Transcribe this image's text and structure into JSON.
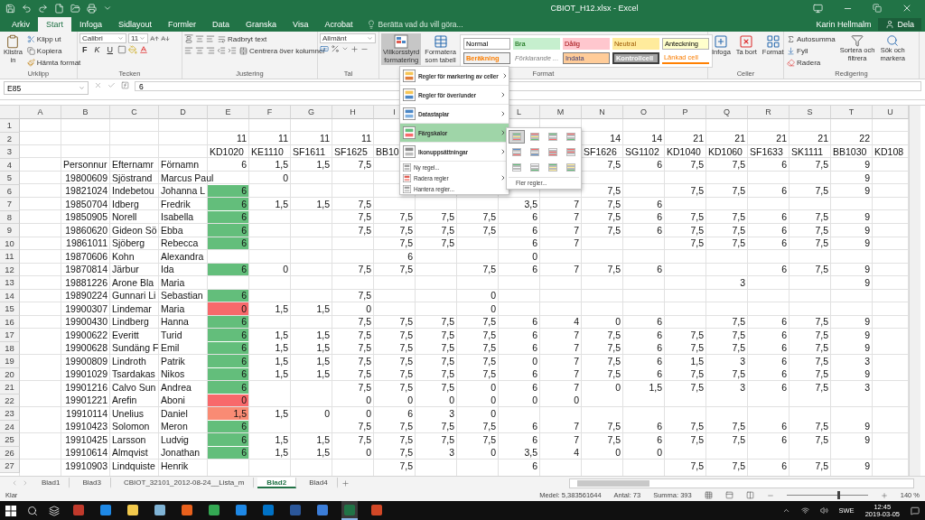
{
  "title_bar": {
    "title": "CBIOT_H12.xlsx - Excel"
  },
  "ribbon_tabs": [
    {
      "label": "Arkiv",
      "selected": false
    },
    {
      "label": "Start",
      "selected": true
    },
    {
      "label": "Infoga",
      "selected": false
    },
    {
      "label": "Sidlayout",
      "selected": false
    },
    {
      "label": "Formler",
      "selected": false
    },
    {
      "label": "Data",
      "selected": false
    },
    {
      "label": "Granska",
      "selected": false
    },
    {
      "label": "Visa",
      "selected": false
    },
    {
      "label": "Acrobat",
      "selected": false
    }
  ],
  "tell_me": {
    "placeholder": "Berätta vad du vill göra..."
  },
  "user": "Karin Hellmalm",
  "share_button": "Dela",
  "ribbon": {
    "clipboard": {
      "label": "Urklipp",
      "paste_top": "Klistra",
      "paste_bottom": "in",
      "cut": "Klipp ut",
      "copy": "Kopiera",
      "format_painter": "Hämta format"
    },
    "font": {
      "label": "Tecken",
      "font_name": "Calibri",
      "font_size": "11",
      "bold": "F",
      "italic": "K",
      "underline": "U"
    },
    "alignment": {
      "label": "Justering",
      "wrap": "Radbryt text",
      "merge": "Centrera över kolumner"
    },
    "number": {
      "label": "Tal",
      "format": "Allmänt"
    },
    "styles": {
      "label": "Format",
      "conditional_top": "Villkorsstyrd",
      "conditional_bottom": "formatering",
      "conditional_open": true,
      "table_top": "Formatera",
      "table_bottom": "som tabell",
      "cell_styles": [
        {
          "label": "Normal",
          "kind": "normal"
        },
        {
          "label": "Bra",
          "kind": "good"
        },
        {
          "label": "Dålig",
          "kind": "bad"
        },
        {
          "label": "Neutral",
          "kind": "neutral"
        },
        {
          "label": "Anteckning",
          "kind": "note"
        },
        {
          "label": "Beräkning",
          "kind": "calc"
        },
        {
          "label": "Förklarande ...",
          "kind": "explanatory"
        },
        {
          "label": "Indata",
          "kind": "input"
        },
        {
          "label": "Kontrollcell",
          "kind": "check"
        },
        {
          "label": "Länkad cell",
          "kind": "linked"
        }
      ]
    },
    "cells": {
      "label": "Celler",
      "insert": "Infoga",
      "delete": "Ta bort",
      "format": "Format"
    },
    "editing": {
      "label": "Redigering",
      "autosum": "Autosumma",
      "fill": "Fyll",
      "clear": "Radera",
      "sort_top": "Sortera och",
      "sort_bottom": "filtrera",
      "find_top": "Sök och",
      "find_bottom": "markera"
    }
  },
  "formula_bar": {
    "name_box": "E85",
    "value": "6"
  },
  "conditional_menu": {
    "items": [
      {
        "label": "Regler för markering av celler",
        "kind": "large",
        "submenu": true,
        "selected": false
      },
      {
        "label": "Regler för över/under",
        "kind": "large",
        "submenu": true,
        "selected": false
      },
      {
        "label": "Datastaplar",
        "kind": "large",
        "submenu": true,
        "selected": false
      },
      {
        "label": "Färgskalor",
        "kind": "large",
        "submenu": true,
        "selected": true
      },
      {
        "label": "Ikonuppsättningar",
        "kind": "large",
        "submenu": true,
        "selected": false
      },
      {
        "label": "Ny regel...",
        "kind": "small",
        "submenu": false,
        "selected": false
      },
      {
        "label": "Radera regler",
        "kind": "small",
        "submenu": true,
        "selected": false
      },
      {
        "label": "Hantera regler...",
        "kind": "small",
        "submenu": false,
        "selected": false
      }
    ],
    "color_scales": [
      {
        "selected": true
      },
      {
        "selected": false
      },
      {
        "selected": false
      },
      {
        "selected": false
      },
      {
        "selected": false
      },
      {
        "selected": false
      },
      {
        "selected": false
      },
      {
        "selected": false
      },
      {
        "selected": false
      },
      {
        "selected": false
      },
      {
        "selected": false
      },
      {
        "selected": false
      }
    ],
    "more": "Fler regler..."
  },
  "columns": [
    "A",
    "B",
    "C",
    "D",
    "E",
    "F",
    "G",
    "H",
    "I",
    null,
    null,
    "L",
    "M",
    "N",
    "O",
    "P",
    "Q",
    "R",
    "S",
    "T",
    "U"
  ],
  "rows": [
    {
      "number": "1"
    },
    {
      "number": "2",
      "cells": [
        null,
        null,
        null,
        null,
        "11",
        "11",
        "11",
        "11",
        null,
        null,
        null,
        null,
        null,
        "14",
        "14",
        "21",
        "21",
        "21",
        "21",
        "22",
        null
      ]
    },
    {
      "number": "3",
      "cells": [
        null,
        null,
        null,
        null,
        "KD1020",
        "KE1110",
        "SF1611",
        "SF1625",
        "BB10",
        null,
        null,
        null,
        null,
        "SF1626",
        "SG1102",
        "KD1040",
        "KD1060",
        "SF1633",
        "SK1111",
        "BB1030",
        "KD108"
      ]
    },
    {
      "number": "4",
      "cells": [
        null,
        "Personnur",
        "Efternamr",
        "Förnamn",
        "6",
        "1,5",
        "1,5",
        "7,5",
        null,
        null,
        null,
        null,
        null,
        "7,5",
        "6",
        "7,5",
        "7,5",
        "6",
        "7,5",
        "9",
        null
      ]
    },
    {
      "number": "5",
      "cells": [
        null,
        "19800609",
        "Sjöstrand",
        "Marcus Paul",
        null,
        "0",
        null,
        null,
        null,
        null,
        null,
        null,
        null,
        null,
        null,
        null,
        null,
        null,
        null,
        "9",
        null
      ]
    },
    {
      "number": "6",
      "cells": [
        null,
        "19821024",
        "Indebetou",
        "Johanna L",
        {
          "value": "6",
          "color": "#63be7b"
        },
        null,
        null,
        null,
        null,
        null,
        null,
        null,
        null,
        "7,5",
        null,
        "7,5",
        "7,5",
        "6",
        "7,5",
        "9",
        null
      ]
    },
    {
      "number": "7",
      "cells": [
        null,
        "19850704",
        "Idberg",
        "Fredrik",
        {
          "value": "6",
          "color": "#63be7b"
        },
        "1,5",
        "1,5",
        "7,5",
        null,
        null,
        null,
        "3,5",
        "7",
        "7,5",
        "6",
        null,
        null,
        null,
        null,
        null,
        null
      ]
    },
    {
      "number": "8",
      "cells": [
        null,
        "19850905",
        "Norell",
        "Isabella",
        {
          "value": "6",
          "color": "#63be7b"
        },
        null,
        null,
        "7,5",
        "7,5",
        "7,5",
        "7,5",
        "6",
        "7",
        "7,5",
        "6",
        "7,5",
        "7,5",
        "6",
        "7,5",
        "9",
        null
      ]
    },
    {
      "number": "9",
      "cells": [
        null,
        "19860620",
        "Gideon Sö",
        "Ebba",
        {
          "value": "6",
          "color": "#63be7b"
        },
        null,
        null,
        "7,5",
        "7,5",
        "7,5",
        "7,5",
        "6",
        "7",
        "7,5",
        "6",
        "7,5",
        "7,5",
        "6",
        "7,5",
        "9",
        null
      ]
    },
    {
      "number": "10",
      "cells": [
        null,
        "19861011",
        "Sjöberg",
        "Rebecca",
        {
          "value": "6",
          "color": "#63be7b"
        },
        null,
        null,
        null,
        "7,5",
        "7,5",
        null,
        "6",
        "7",
        null,
        null,
        "7,5",
        "7,5",
        "6",
        "7,5",
        "9",
        null
      ]
    },
    {
      "number": "11",
      "cells": [
        null,
        "19870606",
        "Kohn",
        "Alexandra",
        null,
        null,
        null,
        null,
        "6",
        null,
        null,
        "0",
        null,
        null,
        null,
        null,
        null,
        null,
        null,
        null,
        null
      ]
    },
    {
      "number": "12",
      "cells": [
        null,
        "19870814",
        "Järbur",
        "Ida",
        {
          "value": "6",
          "color": "#63be7b"
        },
        "0",
        null,
        "7,5",
        "7,5",
        null,
        "7,5",
        "6",
        "7",
        "7,5",
        "6",
        null,
        null,
        "6",
        "7,5",
        "9",
        null
      ]
    },
    {
      "number": "13",
      "cells": [
        null,
        "19881226",
        "Arone Bla",
        "Maria",
        null,
        null,
        null,
        null,
        null,
        null,
        null,
        null,
        null,
        null,
        null,
        null,
        "3",
        null,
        null,
        "9",
        null
      ]
    },
    {
      "number": "14",
      "cells": [
        null,
        "19890224",
        "Gunnari Li",
        "Sebastian",
        {
          "value": "6",
          "color": "#63be7b"
        },
        null,
        null,
        "7,5",
        null,
        null,
        "0",
        null,
        null,
        null,
        null,
        null,
        null,
        null,
        null,
        null,
        null
      ]
    },
    {
      "number": "15",
      "cells": [
        null,
        "19900307",
        "Lindemar",
        "Maria",
        {
          "value": "0",
          "color": "#f8696b"
        },
        "1,5",
        "1,5",
        "0",
        null,
        null,
        "0",
        null,
        null,
        null,
        null,
        null,
        null,
        null,
        null,
        null,
        null
      ]
    },
    {
      "number": "16",
      "cells": [
        null,
        "19900430",
        "Lindberg",
        "Hanna",
        {
          "value": "6",
          "color": "#63be7b"
        },
        null,
        null,
        "7,5",
        "7,5",
        "7,5",
        "7,5",
        "6",
        "4",
        "0",
        "6",
        null,
        "7,5",
        "6",
        "7,5",
        "9",
        null
      ]
    },
    {
      "number": "17",
      "cells": [
        null,
        "19900622",
        "Everitt",
        "Turid",
        {
          "value": "6",
          "color": "#63be7b"
        },
        "1,5",
        "1,5",
        "7,5",
        "7,5",
        "7,5",
        "7,5",
        "6",
        "7",
        "7,5",
        "6",
        "7,5",
        "7,5",
        "6",
        "7,5",
        "9",
        null
      ]
    },
    {
      "number": "18",
      "cells": [
        null,
        "19900628",
        "Sundäng F",
        "Emil",
        {
          "value": "6",
          "color": "#63be7b"
        },
        "1,5",
        "1,5",
        "7,5",
        "7,5",
        "7,5",
        "7,5",
        "6",
        "7",
        "7,5",
        "6",
        "7,5",
        "7,5",
        "6",
        "7,5",
        "9",
        null
      ]
    },
    {
      "number": "19",
      "cells": [
        null,
        "19900809",
        "Lindroth",
        "Patrik",
        {
          "value": "6",
          "color": "#63be7b"
        },
        "1,5",
        "1,5",
        "7,5",
        "7,5",
        "7,5",
        "7,5",
        "0",
        "7",
        "7,5",
        "6",
        "1,5",
        "3",
        "6",
        "7,5",
        "3",
        null
      ]
    },
    {
      "number": "20",
      "cells": [
        null,
        "19901029",
        "Tsardakas",
        "Nikos",
        {
          "value": "6",
          "color": "#63be7b"
        },
        "1,5",
        "1,5",
        "7,5",
        "7,5",
        "7,5",
        "7,5",
        "6",
        "7",
        "7,5",
        "6",
        "7,5",
        "7,5",
        "6",
        "7,5",
        "9",
        null
      ]
    },
    {
      "number": "21",
      "cells": [
        null,
        "19901216",
        "Calvo Sun",
        "Andrea",
        {
          "value": "6",
          "color": "#63be7b"
        },
        null,
        null,
        "7,5",
        "7,5",
        "7,5",
        "0",
        "6",
        "7",
        "0",
        "1,5",
        "7,5",
        "3",
        "6",
        "7,5",
        "3",
        null
      ]
    },
    {
      "number": "22",
      "cells": [
        null,
        "19901221",
        "Arefin",
        "Aboni",
        {
          "value": "0",
          "color": "#f8696b"
        },
        null,
        null,
        "0",
        "0",
        "0",
        "0",
        "0",
        "0",
        null,
        null,
        null,
        null,
        null,
        null,
        null,
        null
      ]
    },
    {
      "number": "23",
      "cells": [
        null,
        "19910114",
        "Unelius",
        "Daniel",
        {
          "value": "1,5",
          "color": "#f98b74"
        },
        "1,5",
        "0",
        "0",
        "6",
        "3",
        "0",
        null,
        null,
        null,
        null,
        null,
        null,
        null,
        null,
        null,
        null
      ]
    },
    {
      "number": "24",
      "cells": [
        null,
        "19910423",
        "Solomon",
        "Meron",
        {
          "value": "6",
          "color": "#63be7b"
        },
        null,
        null,
        "7,5",
        "7,5",
        "7,5",
        "7,5",
        "6",
        "7",
        "7,5",
        "6",
        "7,5",
        "7,5",
        "6",
        "7,5",
        "9",
        null
      ]
    },
    {
      "number": "25",
      "cells": [
        null,
        "19910425",
        "Larsson",
        "Ludvig",
        {
          "value": "6",
          "color": "#63be7b"
        },
        "1,5",
        "1,5",
        "7,5",
        "7,5",
        "7,5",
        "7,5",
        "6",
        "7",
        "7,5",
        "6",
        "7,5",
        "7,5",
        "6",
        "7,5",
        "9",
        null
      ]
    },
    {
      "number": "26",
      "cells": [
        null,
        "19910614",
        "Almqvist",
        "Jonathan",
        {
          "value": "6",
          "color": "#63be7b"
        },
        "1,5",
        "1,5",
        "0",
        "7,5",
        "3",
        "0",
        "3,5",
        "4",
        "0",
        "0",
        null,
        null,
        null,
        null,
        null,
        null
      ]
    },
    {
      "number": "27",
      "cells": [
        null,
        "19910903",
        "Lindquiste",
        "Henrik",
        null,
        null,
        null,
        null,
        "7,5",
        null,
        null,
        "6",
        null,
        null,
        null,
        "7,5",
        "7,5",
        "6",
        "7,5",
        "9",
        null
      ]
    }
  ],
  "sheet_tabs": [
    {
      "label": "Blad1",
      "selected": false
    },
    {
      "label": "Blad3",
      "selected": false
    },
    {
      "label": "CBIOT_32101_2012-08-24__Lista_m",
      "selected": false
    },
    {
      "label": "Blad2",
      "selected": true
    },
    {
      "label": "Blad4",
      "selected": false
    }
  ],
  "status_bar": {
    "status": "Klar",
    "average": "Medel: 5,383561644",
    "count": "Antal: 73",
    "sum": "Summa: 393",
    "zoom": "140 %",
    "zoom_slider": {
      "level": 0.62
    }
  },
  "taskbar": {
    "apps": [
      {
        "color": "#c0392b",
        "selected": false
      },
      {
        "color": "#1e88e5",
        "selected": false
      },
      {
        "color": "#f2c94c",
        "selected": false
      },
      {
        "color": "#7fb3d5",
        "selected": false
      },
      {
        "color": "#e8601c",
        "selected": false
      },
      {
        "color": "#34a853",
        "selected": false
      },
      {
        "color": "#1e88e5",
        "selected": false
      },
      {
        "color": "#0072c6",
        "selected": false
      },
      {
        "color": "#2b579a",
        "selected": false
      },
      {
        "color": "#3b7dd8",
        "selected": false
      },
      {
        "color": "#217346",
        "selected": true
      },
      {
        "color": "#d24726",
        "selected": false
      }
    ],
    "language": "SWE",
    "time": "12:45",
    "date": "2019-03-05"
  }
}
